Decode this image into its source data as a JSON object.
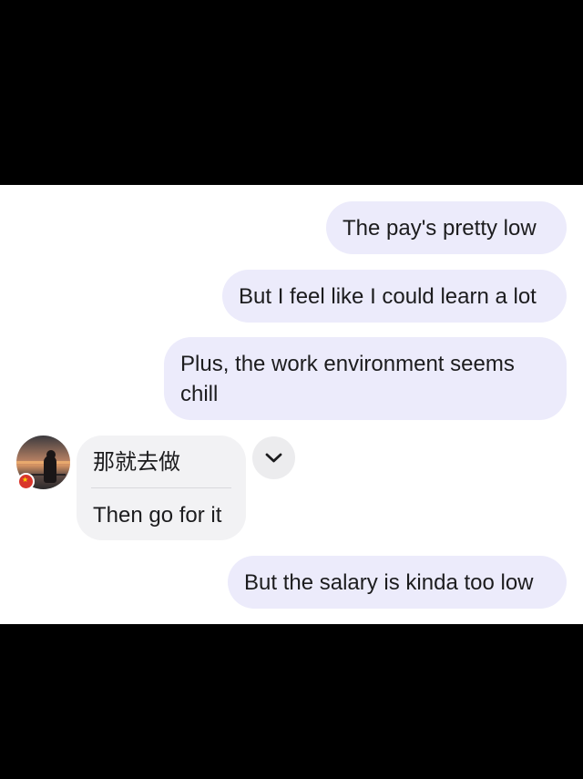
{
  "messages": [
    {
      "direction": "outgoing",
      "text": "The pay's pretty low"
    },
    {
      "direction": "outgoing",
      "text": "But I feel like I could learn a lot"
    },
    {
      "direction": "outgoing",
      "text_line1": "Plus, the work environment seems",
      "text_line2": "chill"
    },
    {
      "direction": "incoming",
      "original": "那就去做",
      "translation": "Then go for it"
    },
    {
      "direction": "outgoing",
      "text": "But the salary is kinda too low"
    }
  ],
  "contact": {
    "avatar_icon": "avatar-sunset-photo",
    "status_badge_icon": "flag-badge-icon"
  },
  "actions": {
    "expand_icon": "chevron-down-icon"
  },
  "colors": {
    "outgoing_bubble": "#ecebfb",
    "incoming_bubble": "#f2f2f4",
    "background": "#ffffff",
    "letterbox": "#000000",
    "text": "#1c1c1e"
  }
}
